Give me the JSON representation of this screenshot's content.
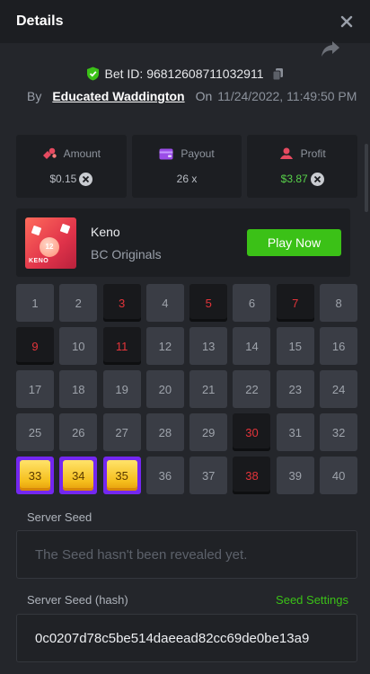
{
  "header": {
    "title": "Details"
  },
  "bet": {
    "id_label": "Bet ID: 96812608711032911",
    "by_label": "By",
    "user": "Educated Waddington",
    "on_label": "On",
    "date": "11/24/2022, 11:49:50 PM"
  },
  "stats": [
    {
      "label": "Amount",
      "value": "$0.15",
      "icon": "coins-icon",
      "color": "#e64a60"
    },
    {
      "label": "Payout",
      "value": "26 x",
      "icon": "wallet-icon",
      "color": "#9b4de8"
    },
    {
      "label": "Profit",
      "value": "$3.87",
      "icon": "profit-icon",
      "color": "#e64a60"
    }
  ],
  "game": {
    "name": "Keno",
    "provider": "BC Originals",
    "play_label": "Play Now",
    "thumb_ball": "12",
    "thumb_text": "KENO"
  },
  "grid": {
    "numbers": [
      "1",
      "2",
      "3",
      "4",
      "5",
      "6",
      "7",
      "8",
      "9",
      "10",
      "11",
      "12",
      "13",
      "14",
      "15",
      "16",
      "17",
      "18",
      "19",
      "20",
      "21",
      "22",
      "23",
      "24",
      "25",
      "26",
      "27",
      "28",
      "29",
      "30",
      "31",
      "32",
      "33",
      "34",
      "35",
      "36",
      "37",
      "38",
      "39",
      "40"
    ],
    "miss": [
      "3",
      "5",
      "7",
      "9",
      "11",
      "30",
      "38"
    ],
    "hit": [
      "33",
      "34",
      "35"
    ]
  },
  "seeds": {
    "server_seed_label": "Server Seed",
    "server_seed_placeholder": "The Seed hasn't been revealed yet.",
    "hash_label": "Server Seed (hash)",
    "settings_label": "Seed Settings",
    "hash_value": "0c0207d78c5be514daeead82cc69de0be13a9"
  },
  "colors": {
    "accent_green": "#3bc117",
    "hit_purple": "#7427f0",
    "miss_red": "#e3343a"
  }
}
